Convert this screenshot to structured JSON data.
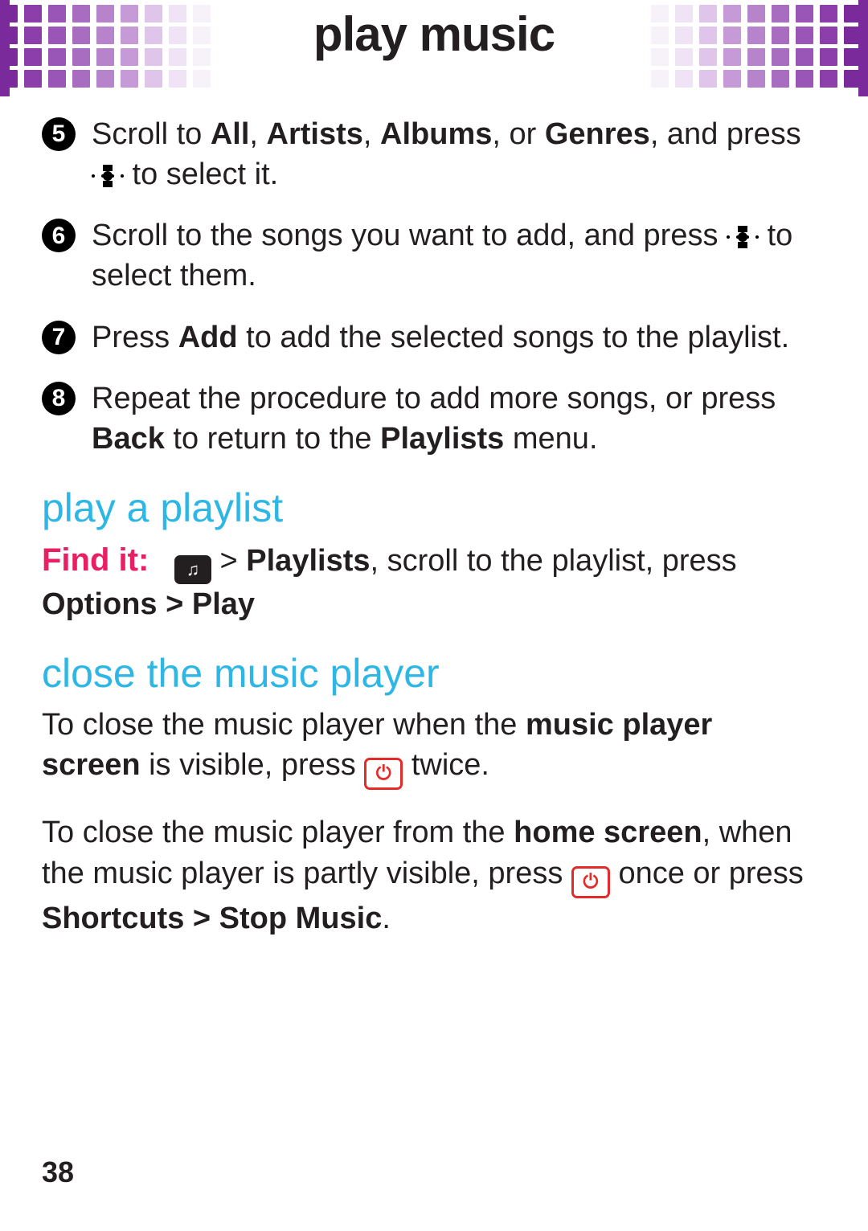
{
  "header": {
    "title": "play music"
  },
  "steps": {
    "s5": {
      "num": "5",
      "pre": "Scroll to ",
      "b1": "All",
      "sep1": ", ",
      "b2": "Artists",
      "sep2": ", ",
      "b3": "Albums",
      "sep3": ", or ",
      "b4": "Genres",
      "mid": ", and press ",
      "post": " to select it."
    },
    "s6": {
      "num": "6",
      "pre": "Scroll to the songs you want to add, and press ",
      "post": " to select them."
    },
    "s7": {
      "num": "7",
      "pre": "Press ",
      "b1": "Add",
      "post": " to add the selected songs to the playlist."
    },
    "s8": {
      "num": "8",
      "pre": "Repeat the procedure to add more songs, or press ",
      "b1": "Back",
      "mid": " to return to the ",
      "b2": "Playlists",
      "post": " menu."
    }
  },
  "section_play": {
    "heading": "play a playlist",
    "find_label": "Find it:",
    "sep1": " > ",
    "b1": "Playlists",
    "mid": ", scroll to the playlist, press ",
    "b2": "Options > Play"
  },
  "section_close": {
    "heading": "close the music player",
    "p1_pre": "To close the music player when the ",
    "p1_b1": "music player screen",
    "p1_mid": " is visible, press ",
    "p1_post": " twice.",
    "p2_pre": "To close the music player from the ",
    "p2_b1": "home screen",
    "p2_mid1": ", when the music player is partly visible, press ",
    "p2_mid2": " once or press ",
    "p2_b2": "Shortcuts > Stop Music",
    "p2_post": "."
  },
  "page_number": "38"
}
